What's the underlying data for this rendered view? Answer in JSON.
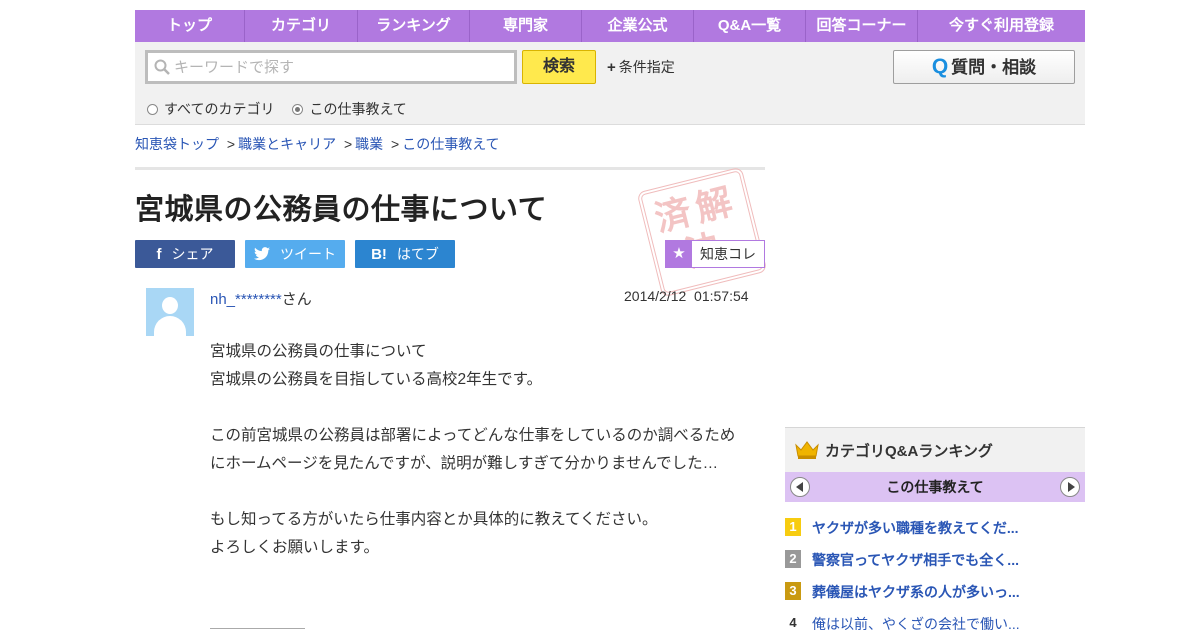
{
  "nav": {
    "items": [
      {
        "label": "トップ"
      },
      {
        "label": "カテゴリ"
      },
      {
        "label": "ランキング"
      },
      {
        "label": "専門家"
      },
      {
        "label": "企業公式"
      },
      {
        "label": "Q&A一覧"
      },
      {
        "label": "回答コーナー"
      },
      {
        "label": "今すぐ利用登録"
      }
    ]
  },
  "search": {
    "placeholder": "キーワードで探す",
    "button_label": "検索",
    "condition_label": "条件指定",
    "ask_button_q": "Q",
    "ask_button_label": "質問・相談",
    "scope_all": "すべてのカテゴリ",
    "scope_this": "この仕事教えて",
    "selected_scope": "この仕事教えて"
  },
  "breadcrumb": [
    {
      "label": "知恵袋トップ"
    },
    {
      "label": "職業とキャリア"
    },
    {
      "label": "職業"
    },
    {
      "label": "この仕事教えて"
    }
  ],
  "breadcrumb_sep": ">",
  "question": {
    "title": "宮城県の公務員の仕事について",
    "stamp_text": "済解決",
    "user_name": "nh_********",
    "user_suffix": "さん",
    "datetime": "2014/2/12  01:57:54",
    "body": {
      "line1": "宮城県の公務員の仕事について",
      "line2": "宮城県の公務員を目指している高校2年生です。",
      "line3": "この前宮城県の公務員は部署によってどんな仕事をしているのか調べるためにホームページを見たんですが、説明が難しすぎて分かりませんでした…",
      "line4": "もし知ってる方がいたら仕事内容とか具体的に教えてください。",
      "line5": "よろしくお願いします。"
    }
  },
  "share": {
    "facebook": "シェア",
    "twitter": "ツイート",
    "hatena": "はてブ",
    "hatena_icon": "B!",
    "chiecolle": "知恵コレ"
  },
  "ranking": {
    "title": "カテゴリQ&Aランキング",
    "category": "この仕事教えて",
    "items": [
      {
        "rank": "1",
        "text": "ヤクザが多い職種を教えてくだ..."
      },
      {
        "rank": "2",
        "text": "警察官ってヤクザ相手でも全く..."
      },
      {
        "rank": "3",
        "text": "葬儀屋はヤクザ系の人が多いっ..."
      },
      {
        "rank": "4",
        "text": "俺は以前、やくざの会社で働い..."
      }
    ]
  },
  "colors": {
    "nav_purple": "#b179e0",
    "search_yellow": "#ffe94d",
    "link_blue": "#2a56b5",
    "facebook": "#3b5998",
    "twitter": "#55acee",
    "hatena": "#2c85d0"
  }
}
